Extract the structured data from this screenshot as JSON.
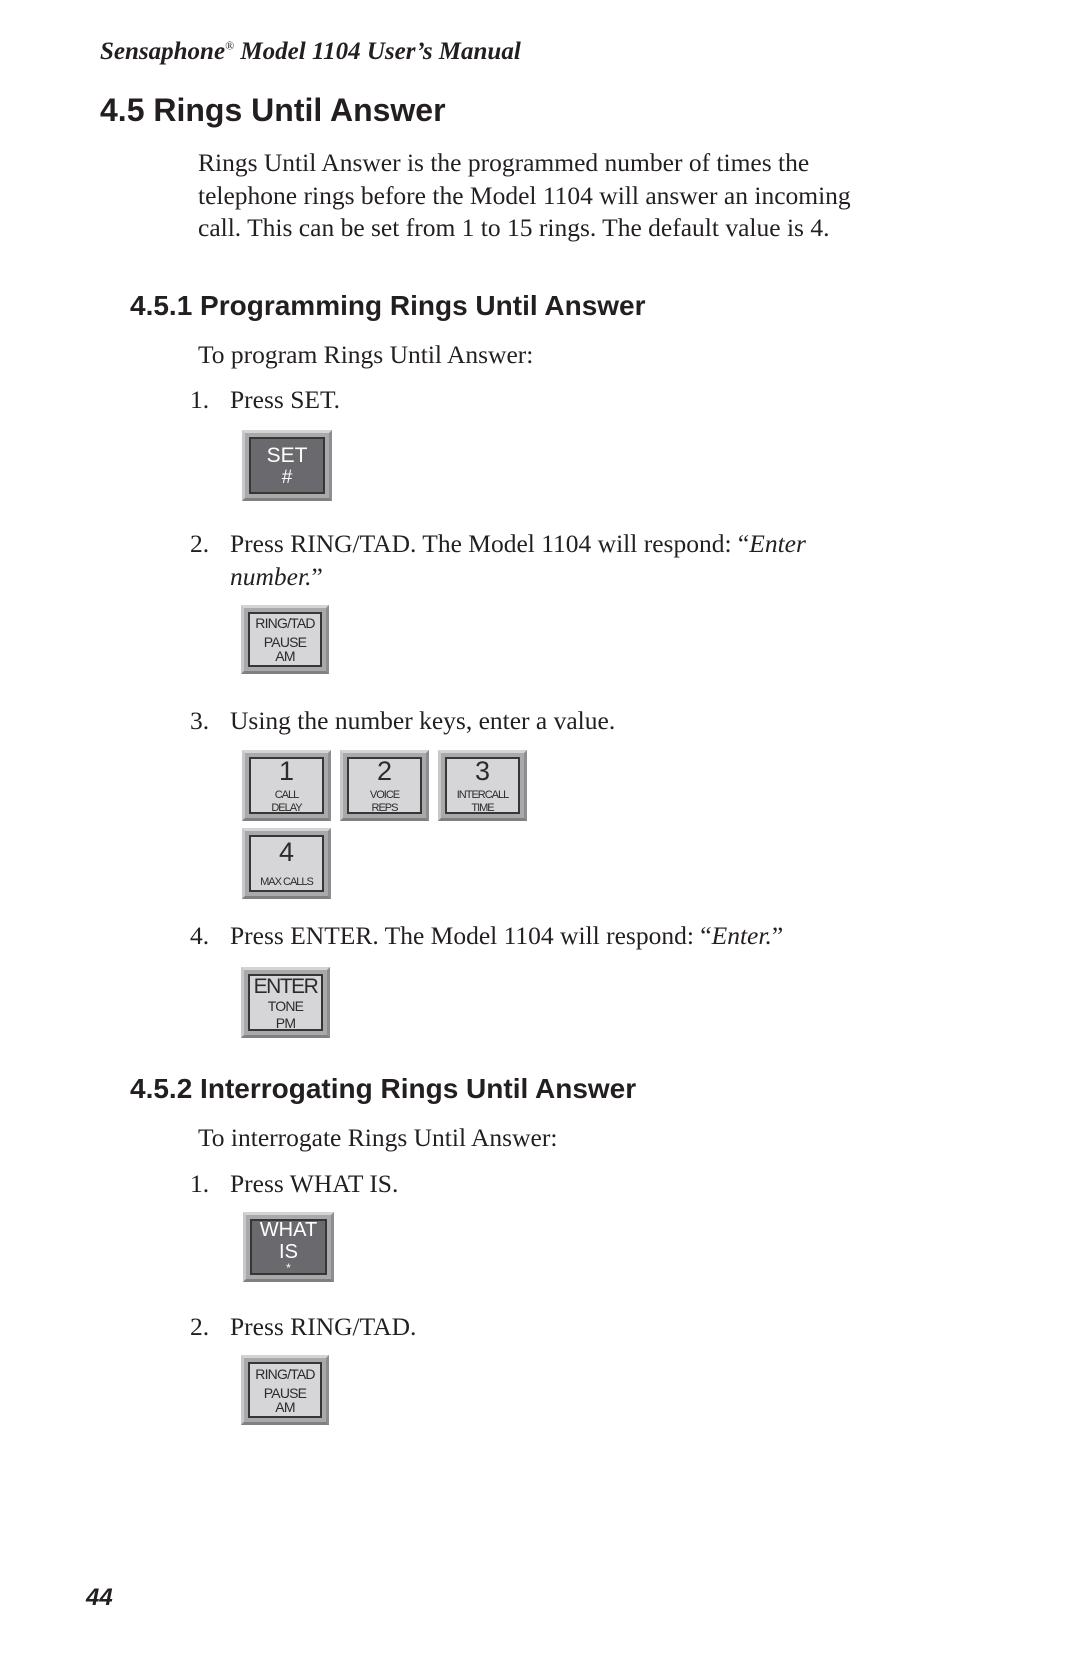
{
  "header": {
    "brand": "Sensaphone",
    "registered_mark": "®",
    "title_rest": " Model 1104 User’s Manual"
  },
  "section": {
    "title": "4.5  Rings Until Answer",
    "intro_lines": [
      "Rings Until Answer is the programmed number of times the",
      "telephone rings before the Model 1104 will answer an incoming",
      "call. This can be set from 1 to 15 rings. The default value is 4."
    ]
  },
  "programming": {
    "title": "4.5.1  Programming Rings Until Answer",
    "lead": "To program Rings Until Answer:",
    "steps": [
      {
        "num": "1.",
        "text": "Press SET."
      },
      {
        "num": "2.",
        "text": "Press RING/TAD. The Model 1104 will respond: “",
        "italic": "Enter",
        "line2_italic": "number.",
        "line2_end": "”"
      },
      {
        "num": "3.",
        "text": "Using the number keys, enter a value."
      },
      {
        "num": "4.",
        "text": "Press ENTER. The Model 1104 will respond: “",
        "italic": "Enter.",
        "end": "”"
      }
    ],
    "keys": {
      "set": {
        "top": "SET",
        "bottom": "#"
      },
      "ring_tad": {
        "top": "RING/TAD",
        "mid": "PAUSE",
        "bottom": "AM"
      },
      "numbers": [
        {
          "digit": "1",
          "l1": "CALL",
          "l2": "DELAY"
        },
        {
          "digit": "2",
          "l1": "VOICE",
          "l2": "REPS"
        },
        {
          "digit": "3",
          "l1": "INTERCALL",
          "l2": "TIME"
        },
        {
          "digit": "4",
          "l1": "MAX CALLS"
        }
      ],
      "enter": {
        "top": "ENTER",
        "mid": "TONE",
        "bottom": "PM"
      }
    }
  },
  "interrogating": {
    "title": "4.5.2  Interrogating Rings Until Answer",
    "lead": "To interrogate Rings Until Answer:",
    "steps": [
      {
        "num": "1.",
        "text": "Press WHAT IS."
      },
      {
        "num": "2.",
        "text": "Press RING/TAD."
      }
    ],
    "keys": {
      "what_is": {
        "l1": "WHAT",
        "l2": "IS",
        "l3": "*"
      },
      "ring_tad": {
        "top": "RING/TAD",
        "mid": "PAUSE",
        "bottom": "AM"
      }
    }
  },
  "footer": {
    "page_number": "44"
  }
}
